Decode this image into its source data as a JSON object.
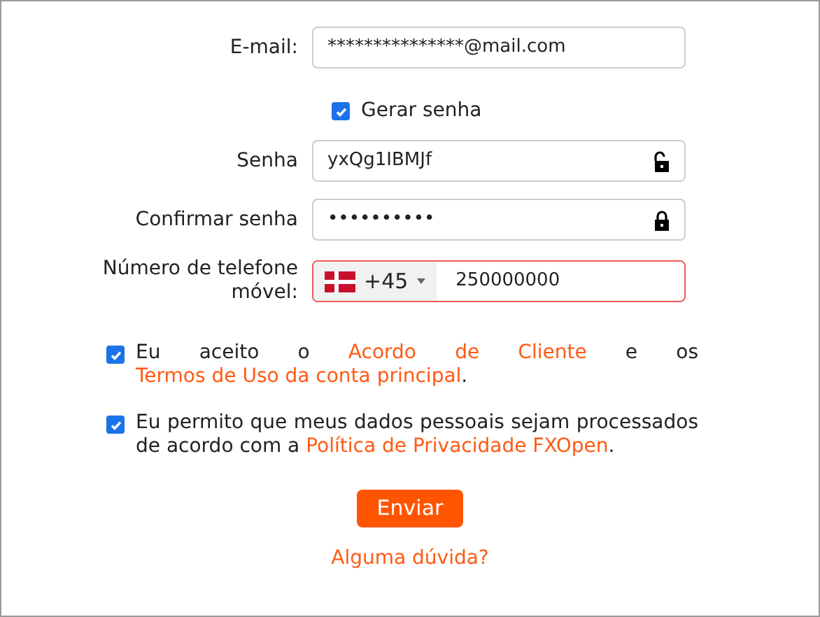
{
  "email": {
    "label": "E-mail:",
    "value": "***************@mail.com"
  },
  "generate_password": {
    "label": "Gerar senha",
    "checked": true
  },
  "password_fields": [
    {
      "label": "Senha",
      "value": "yxQg1IBMJf",
      "locked": false
    },
    {
      "label": "Confirmar senha",
      "value": "••••••••••",
      "locked": true
    }
  ],
  "phone": {
    "label": "Número de telefone móvel:",
    "country_code": "+45",
    "value": "250000000",
    "invalid": true
  },
  "consents": [
    {
      "checked": true,
      "segments": [
        {
          "kind": "text",
          "text": "Eu aceito o "
        },
        {
          "kind": "link",
          "text": "Acordo de Cliente"
        },
        {
          "kind": "text",
          "text": " e os "
        },
        {
          "kind": "link",
          "text": "Termos de Uso da conta principal"
        },
        {
          "kind": "text",
          "text": "."
        }
      ]
    },
    {
      "checked": true,
      "segments": [
        {
          "kind": "text",
          "text": "Eu permito que meus dados pessoais sejam processados de acordo com a "
        },
        {
          "kind": "link",
          "text": "Política de Privacidade FXOpen"
        },
        {
          "kind": "text",
          "text": "."
        }
      ]
    }
  ],
  "submit": "Enviar",
  "help_link": "Alguma dúvida?"
}
